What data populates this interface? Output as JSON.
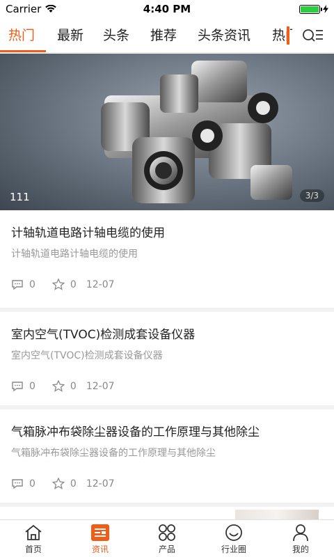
{
  "status": {
    "carrier": "Carrier",
    "time": "4:40 PM"
  },
  "tabs": [
    "热门",
    "最新",
    "头条",
    "推荐",
    "头条资讯",
    "热门"
  ],
  "banner": {
    "caption": "111",
    "counter": "3/3"
  },
  "news": [
    {
      "title": "计轴轨道电路计轴电缆的使用",
      "subtitle": "计轴轨道电路计轴电缆的使用",
      "comments": "0",
      "favorites": "0",
      "date": "12-07"
    },
    {
      "title": "室内空气(TVOC)检测成套设备仪器",
      "subtitle": "室内空气(TVOC)检测成套设备仪器",
      "comments": "0",
      "favorites": "0",
      "date": "12-07"
    },
    {
      "title": "气箱脉冲布袋除尘器设备的工作原理与其他除尘",
      "subtitle": "气箱脉冲布袋除尘器设备的工作原理与其他除尘",
      "comments": "0",
      "favorites": "0",
      "date": "12-07"
    }
  ],
  "bottom_nav": [
    {
      "label": "首页",
      "icon": "home-icon"
    },
    {
      "label": "资讯",
      "icon": "news-icon"
    },
    {
      "label": "产品",
      "icon": "products-icon"
    },
    {
      "label": "行业圈",
      "icon": "industry-circle-icon"
    },
    {
      "label": "我的",
      "icon": "profile-icon"
    }
  ],
  "colors": {
    "accent": "#f25c19",
    "battery": "#2ecc40"
  }
}
